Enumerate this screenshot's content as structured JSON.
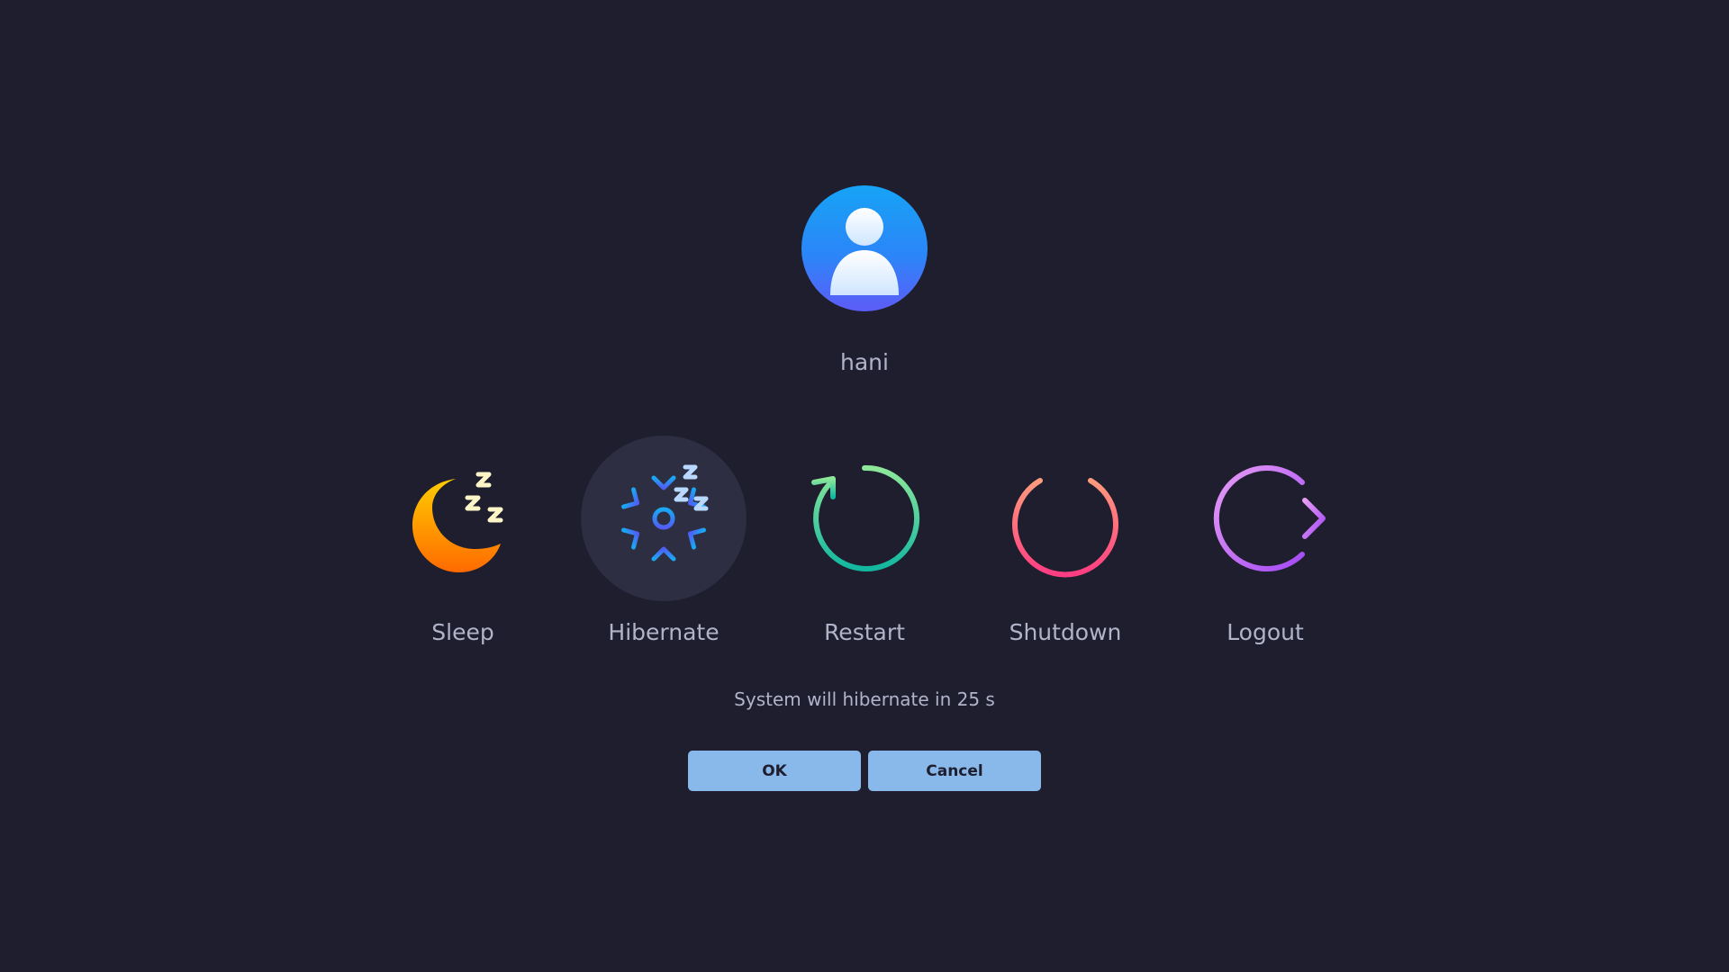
{
  "user": {
    "name": "hani",
    "avatar_icon": "user-avatar-icon"
  },
  "actions": [
    {
      "label": "Sleep",
      "icon": "moon-icon",
      "selected": false
    },
    {
      "label": "Hibernate",
      "icon": "snowflake-icon",
      "selected": true
    },
    {
      "label": "Restart",
      "icon": "restart-icon",
      "selected": false
    },
    {
      "label": "Shutdown",
      "icon": "power-icon",
      "selected": false
    },
    {
      "label": "Logout",
      "icon": "logout-icon",
      "selected": false
    }
  ],
  "status": "System will hibernate in 25 s",
  "buttons": {
    "ok_label": "OK",
    "cancel_label": "Cancel"
  },
  "colors": {
    "background": "#1e1e2e",
    "text": "#b1b4c9",
    "button": "#89b9eb",
    "selection": "#2d2e41"
  }
}
